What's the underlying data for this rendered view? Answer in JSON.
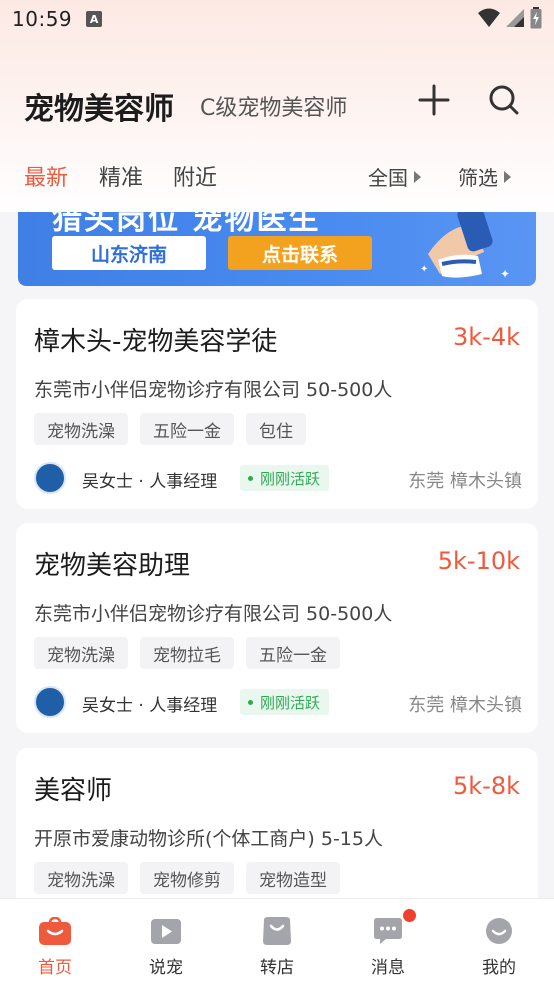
{
  "status_bar": {
    "time": "10:59",
    "notif_letter": "A"
  },
  "header": {
    "title": "宠物美容师",
    "subtitle": "C级宠物美容师"
  },
  "tabs": [
    {
      "label": "最新",
      "active": true
    },
    {
      "label": "精准",
      "active": false
    },
    {
      "label": "附近",
      "active": false
    }
  ],
  "filters": {
    "region": "全国",
    "screen": "筛选"
  },
  "banner": {
    "headline": "猎头岗位 宠物医生",
    "city": "山东济南",
    "cta": "点击联系"
  },
  "jobs": [
    {
      "title": "樟木头-宠物美容学徒",
      "salary": "3k-4k",
      "company": "东莞市小伴侣宠物诊疗有限公司 50-500人",
      "tags": [
        "宠物洗澡",
        "五险一金",
        "包住"
      ],
      "recruiter": "吴女士 · 人事经理",
      "activity": "刚刚活跃",
      "location": "东莞  樟木头镇"
    },
    {
      "title": "宠物美容助理",
      "salary": "5k-10k",
      "company": "东莞市小伴侣宠物诊疗有限公司 50-500人",
      "tags": [
        "宠物洗澡",
        "宠物拉毛",
        "五险一金"
      ],
      "recruiter": "吴女士 · 人事经理",
      "activity": "刚刚活跃",
      "location": "东莞  樟木头镇"
    },
    {
      "title": "美容师",
      "salary": "5k-8k",
      "company": "开原市爱康动物诊所(个体工商户) 5-15人",
      "tags": [
        "宠物洗澡",
        "宠物修剪",
        "宠物造型"
      ]
    }
  ],
  "bottom_nav": [
    {
      "label": "首页",
      "icon": "home-bag-icon",
      "active": true
    },
    {
      "label": "说宠",
      "icon": "video-play-icon",
      "active": false
    },
    {
      "label": "转店",
      "icon": "shop-bag-icon",
      "active": false
    },
    {
      "label": "消息",
      "icon": "message-icon",
      "active": false,
      "has_badge": true
    },
    {
      "label": "我的",
      "icon": "profile-face-icon",
      "active": false
    }
  ],
  "colors": {
    "accent": "#f05a3c",
    "banner_blue": "#3f7fe6",
    "active_green": "#2eaa55"
  }
}
